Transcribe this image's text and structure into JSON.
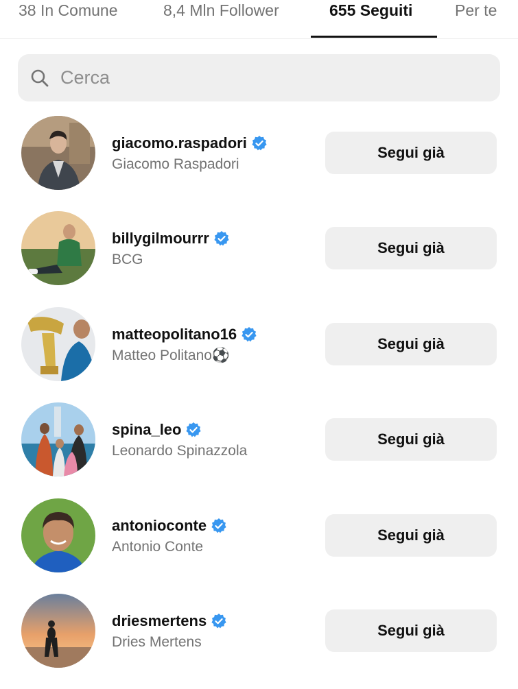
{
  "tabs": [
    {
      "label": "38 In Comune"
    },
    {
      "label": "8,4 Mln Follower"
    },
    {
      "label": "655 Seguiti"
    },
    {
      "label": "Per te"
    }
  ],
  "search": {
    "placeholder": "Cerca"
  },
  "users": [
    {
      "username": "giacomo.raspadori",
      "full_name": "Giacomo Raspadori",
      "verified": true,
      "button_label": "Segui già"
    },
    {
      "username": "billygilmourrr",
      "full_name": "BCG",
      "verified": true,
      "button_label": "Segui già"
    },
    {
      "username": "matteopolitano16",
      "full_name": "Matteo Politano⚽",
      "verified": true,
      "button_label": "Segui già"
    },
    {
      "username": "spina_leo",
      "full_name": "Leonardo Spinazzola",
      "verified": true,
      "button_label": "Segui già"
    },
    {
      "username": "antonioconte",
      "full_name": "Antonio Conte",
      "verified": true,
      "button_label": "Segui già"
    },
    {
      "username": "driesmertens",
      "full_name": "Dries Mertens",
      "verified": true,
      "button_label": "Segui già"
    }
  ],
  "colors": {
    "verified": "#3897f0",
    "button_bg": "#efefef",
    "secondary_text": "#737373"
  }
}
